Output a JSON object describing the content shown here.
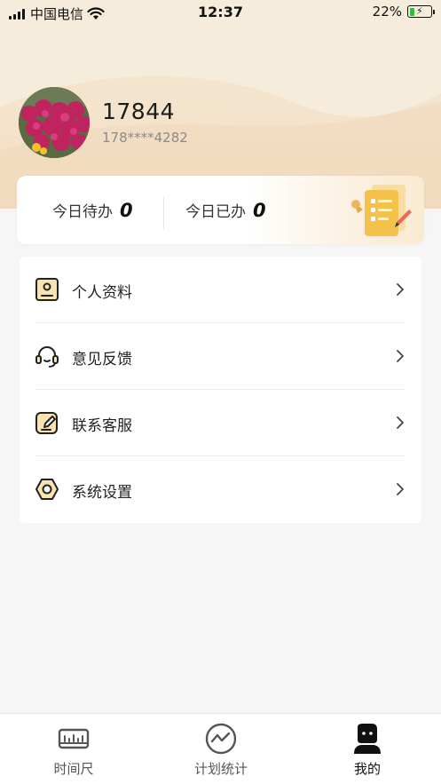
{
  "status_bar": {
    "carrier": "中国电信",
    "time": "12:37",
    "battery": "22%",
    "battery_level": 0.22,
    "wifi_icon": "wifi-icon",
    "signal_icon": "signal-bars-icon"
  },
  "profile": {
    "username": "17844",
    "phone": "178****4282",
    "avatar_icon": "flower-photo-avatar"
  },
  "stats": {
    "todo_label": "今日待办",
    "todo_value": "0",
    "done_label": "今日已办",
    "done_value": "0",
    "illustration_icon": "clipboard-checklist-icon"
  },
  "menu": {
    "items": [
      {
        "label": "个人资料",
        "icon": "profile-card-icon"
      },
      {
        "label": "意见反馈",
        "icon": "headset-icon"
      },
      {
        "label": "联系客服",
        "icon": "edit-note-icon"
      },
      {
        "label": "系统设置",
        "icon": "hex-nut-settings-icon"
      }
    ]
  },
  "tabs": [
    {
      "label": "时间尺",
      "icon": "ruler-icon",
      "active": false
    },
    {
      "label": "计划统计",
      "icon": "trend-chart-icon",
      "active": false
    },
    {
      "label": "我的",
      "icon": "user-profile-icon",
      "active": true
    }
  ],
  "colors": {
    "header_bg": "#f4e3cc",
    "accent_gold": "#f4c24a",
    "battery_green": "#2fbf3b"
  }
}
